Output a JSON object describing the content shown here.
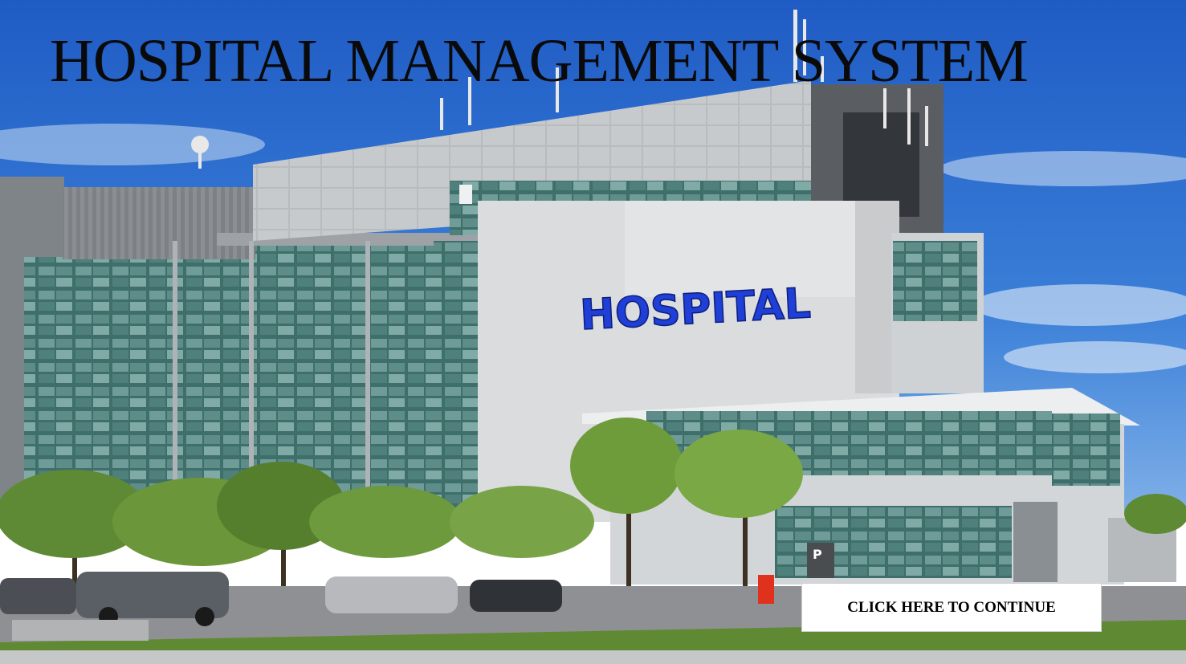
{
  "page": {
    "title": "HOSPITAL MANAGEMENT SYSTEM",
    "continue_label": "CLICK HERE TO CONTINUE"
  },
  "background_photo": {
    "sign_text": "HOSPITAL",
    "parking_sign_text": "P"
  },
  "colors": {
    "sky": "#2f6fce",
    "sign_blue": "#1f3fd6",
    "title_text": "#0a0a0a",
    "button_bg": "#ffffff"
  }
}
